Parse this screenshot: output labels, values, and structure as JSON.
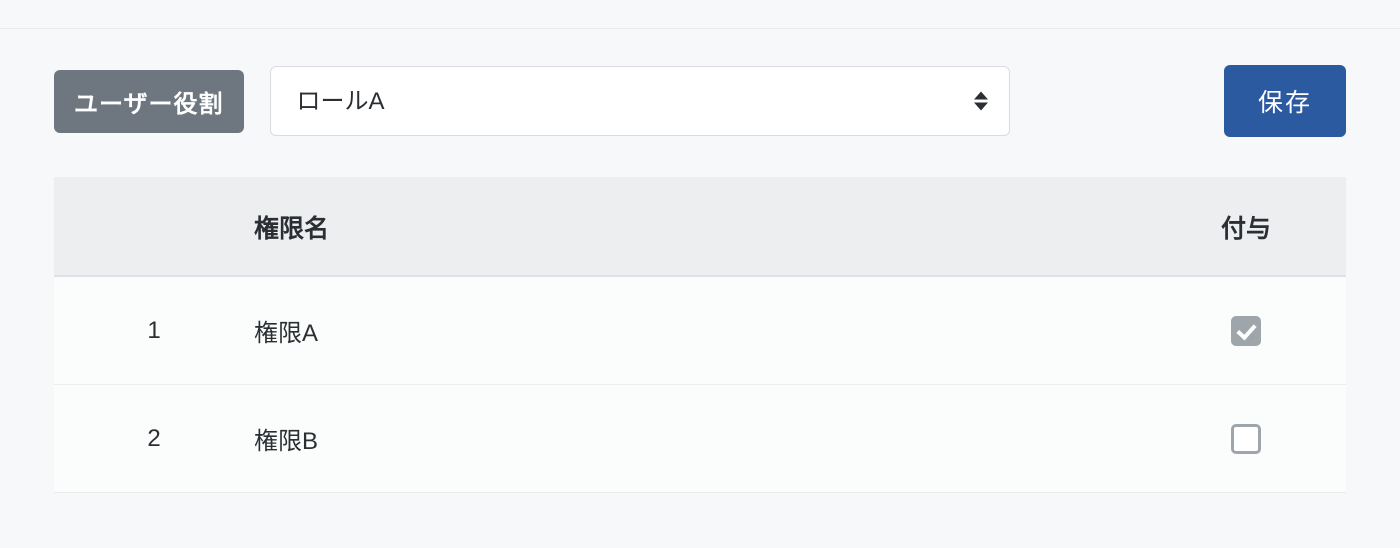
{
  "toolbar": {
    "role_label": "ユーザー役割",
    "role_selected": "ロールA",
    "save_label": "保存"
  },
  "table": {
    "headers": {
      "index": "",
      "name": "権限名",
      "grant": "付与"
    },
    "rows": [
      {
        "index": "1",
        "name": "権限A",
        "granted": true
      },
      {
        "index": "2",
        "name": "権限B",
        "granted": false
      }
    ]
  }
}
